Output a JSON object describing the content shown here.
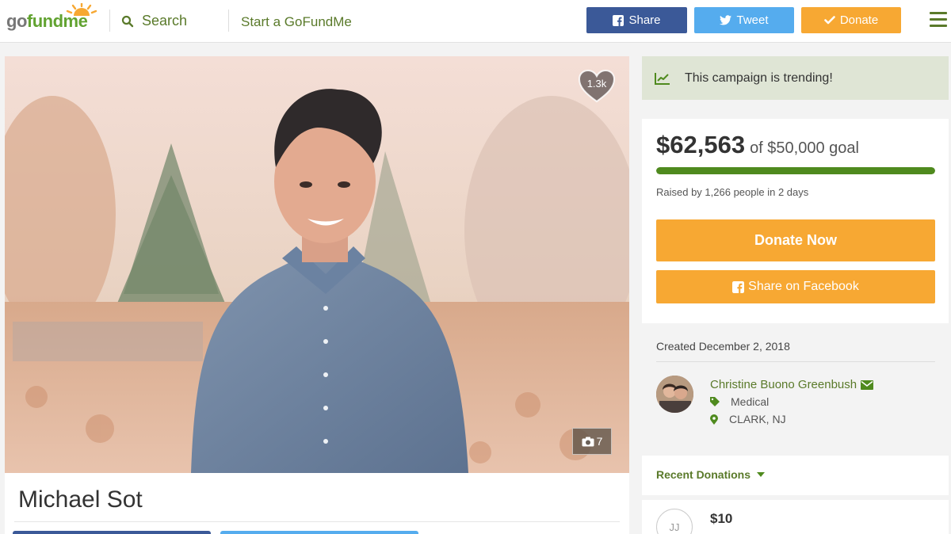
{
  "header": {
    "logo_left": "go",
    "logo_right": "fundme",
    "search_label": "Search",
    "start_label": "Start a GoFundMe",
    "share_label": "Share",
    "tweet_label": "Tweet",
    "donate_label": "Donate"
  },
  "campaign": {
    "title": "Michael Sot",
    "hearts": "1.3k",
    "photo_count": "7"
  },
  "sidebar": {
    "trending_text": "This campaign is trending!",
    "raised_amount": "$62,563",
    "goal_text": "of $50,000 goal",
    "progress_fraction": 1.0,
    "raised_by": "Raised by 1,266 people in 2 days",
    "donate_now_label": "Donate Now",
    "share_facebook_label": "Share on Facebook",
    "created": "Created December 2, 2018",
    "organizer_name": "Christine Buono Greenbush",
    "category": "Medical",
    "location": "CLARK, NJ",
    "recent_donations_label": "Recent Donations",
    "donation_initials": "JJ",
    "donation_amount": "$10"
  },
  "colors": {
    "brand_green": "#62a331",
    "facebook": "#3b5998",
    "twitter": "#55acee",
    "donate_orange": "#f7a833",
    "progress_green": "#4f8a1e"
  }
}
